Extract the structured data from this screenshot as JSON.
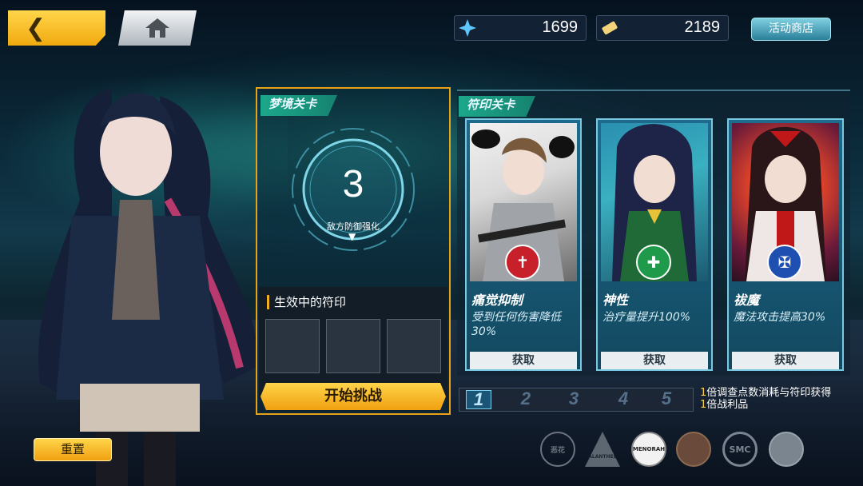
{
  "header": {
    "back_icon": "chevron-left-icon",
    "home_icon": "home-icon",
    "currency": [
      {
        "icon": "crystal-icon",
        "value": "1699"
      },
      {
        "icon": "ticket-icon",
        "value": "2189"
      }
    ],
    "shop_label": "活动商店"
  },
  "dream_stage": {
    "tab_label": "梦境关卡",
    "level": "3",
    "level_desc": "敌方防御强化",
    "active_runes_title": "生效中的符印",
    "slot_count": 3,
    "start_label": "开始挑战"
  },
  "rune_stage": {
    "tab_label": "符印关卡",
    "cards": [
      {
        "name": "痛觉抑制",
        "desc": "受到任何伤害降低30%",
        "get_label": "获取",
        "emblem": "cross-shield-icon",
        "accent": "#c8202a"
      },
      {
        "name": "神性",
        "desc": "治疗量提升100%",
        "get_label": "获取",
        "emblem": "holy-cross-icon",
        "accent": "#1e9a4a"
      },
      {
        "name": "祓魔",
        "desc": "魔法攻击提高30%",
        "get_label": "获取",
        "emblem": "exorcism-icon",
        "accent": "#1f4fb0"
      }
    ],
    "pages": [
      "1",
      "2",
      "3",
      "4",
      "5"
    ],
    "active_page": "1",
    "note_line1_num": "1",
    "note_line1": "倍调查点数消耗与符印获得",
    "note_line2_num": "1",
    "note_line2": "倍战利品"
  },
  "footer": {
    "reset_label": "重置",
    "logos": [
      {
        "icon": "flower-sigil-icon",
        "label": "恶花"
      },
      {
        "icon": "triangle-logo-icon",
        "label": "PALANTHEEL"
      },
      {
        "icon": "menorah-logo-icon",
        "label": "MENORAH"
      },
      {
        "icon": "crest-logo-icon",
        "label": ""
      },
      {
        "icon": "smc-logo-icon",
        "label": "SMC"
      },
      {
        "icon": "hat-logo-icon",
        "label": ""
      }
    ]
  }
}
